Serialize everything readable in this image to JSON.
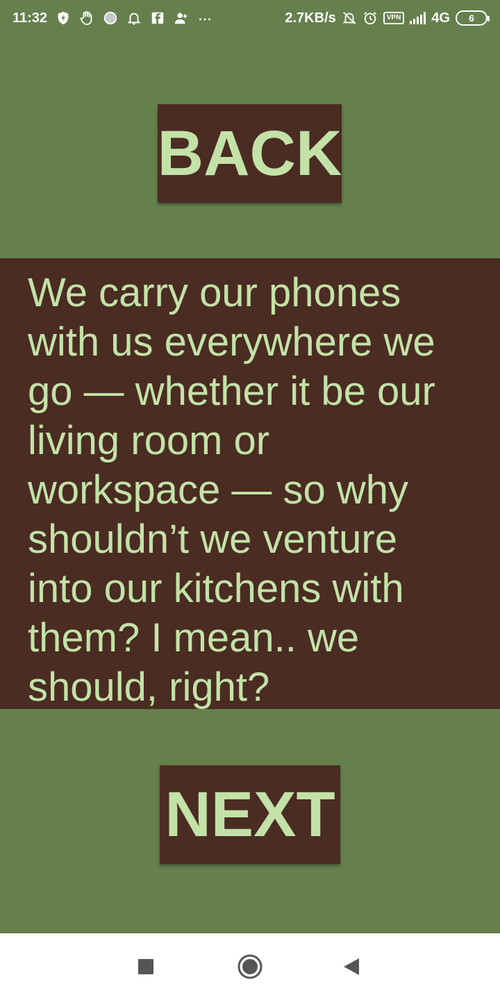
{
  "status_bar": {
    "time": "11:32",
    "network_speed": "2.7KB/s",
    "vpn_label": "VPN",
    "network_type": "4G",
    "battery_level": "6",
    "icons": [
      "shield-bolt-icon",
      "hand-icon",
      "spinner-icon",
      "bell-icon",
      "facebook-icon",
      "add-person-icon",
      "more-dots-icon",
      "bell-muted-icon",
      "alarm-icon",
      "signal-icon",
      "battery-icon"
    ]
  },
  "colors": {
    "background": "#65804d",
    "panel": "#4a2c22",
    "text": "#c3e2a8"
  },
  "back_button": {
    "label": "BACK"
  },
  "next_button": {
    "label": "NEXT"
  },
  "content": {
    "text": "We carry our phones with us everywhere we go — whether it be our living room or workspace — so why shouldn’t we venture into our kitchens with them? I mean.. we should, right?"
  },
  "nav_bar": {
    "icons": [
      "recent-apps-icon",
      "home-icon",
      "back-icon"
    ]
  }
}
